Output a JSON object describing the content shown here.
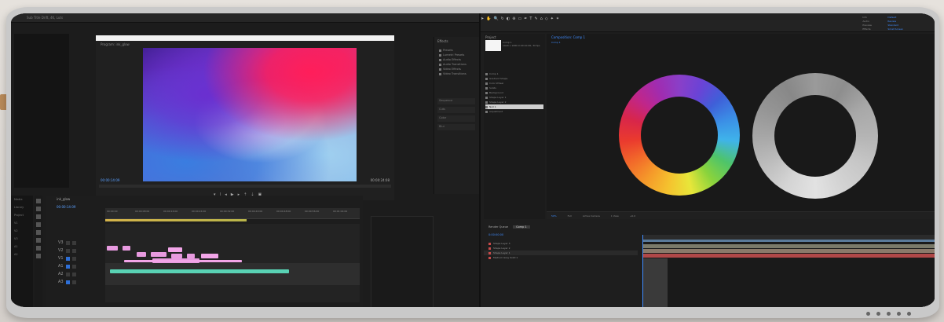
{
  "left_app": {
    "panel_label": "Sub Title Drift, 4K, Luts",
    "program_title": "Program: ink_glow",
    "timecode_left": "00:00:14:09",
    "timecode_right": "00:00:24:08",
    "effects_title": "Effects",
    "effects_items": [
      "Presets",
      "Lumetri Presets",
      "Audio Effects",
      "Audio Transitions",
      "Video Effects",
      "Video Transitions"
    ],
    "effects_fields": [
      "Sequence",
      "Cuts",
      "Color",
      "Blur"
    ],
    "timeline_title": "ink_glow",
    "timeline_time": "00:00:14:09",
    "ruler_labels": [
      "00:00:00",
      "00:00:08:00",
      "00:00:16:00",
      "00:00:24:00",
      "00:00:32:00",
      "00:00:40:00",
      "00:00:48:00",
      "00:00:56:00",
      "00:01:04:00"
    ],
    "side_labels": [
      "Media",
      "Library",
      "Project",
      "V1",
      "V2",
      "V3",
      "A1",
      "A2"
    ],
    "track_names": [
      "V3",
      "V2",
      "V1",
      "A1",
      "A2",
      "A3"
    ]
  },
  "right_app": {
    "project_title": "Project",
    "project_item": "Comp 1",
    "project_info": "1920 x 1080\n0:00:10:00, 30 fps",
    "project_list": [
      "Comp 1",
      "Gradient Shape",
      "Color Wheel",
      "Solids",
      "Background",
      "Shape Layer 1",
      "Shape Layer 2",
      "Null 1",
      "Adjustment"
    ],
    "comp_tab": "Composition: Comp 1",
    "comp_sub": "Comp 1",
    "right_labels": [
      "Info",
      "Audio",
      "Preview",
      "Effects"
    ],
    "blue_labels": [
      "Default",
      "Review",
      "Standard",
      "Small Screen"
    ],
    "bottom_items": [
      "50%",
      "Full",
      "Active Camera",
      "1 View",
      "+0.0"
    ],
    "tl_tabs": [
      "Render Queue",
      "Comp 1"
    ],
    "tl_time": "0:00:00:00",
    "layers": [
      {
        "name": "Shape Layer 3",
        "sel": false
      },
      {
        "name": "Shape Layer 2",
        "sel": false
      },
      {
        "name": "Shape Layer 1",
        "sel": true
      },
      {
        "name": "Medium Gray Solid 1",
        "sel": false
      }
    ]
  }
}
